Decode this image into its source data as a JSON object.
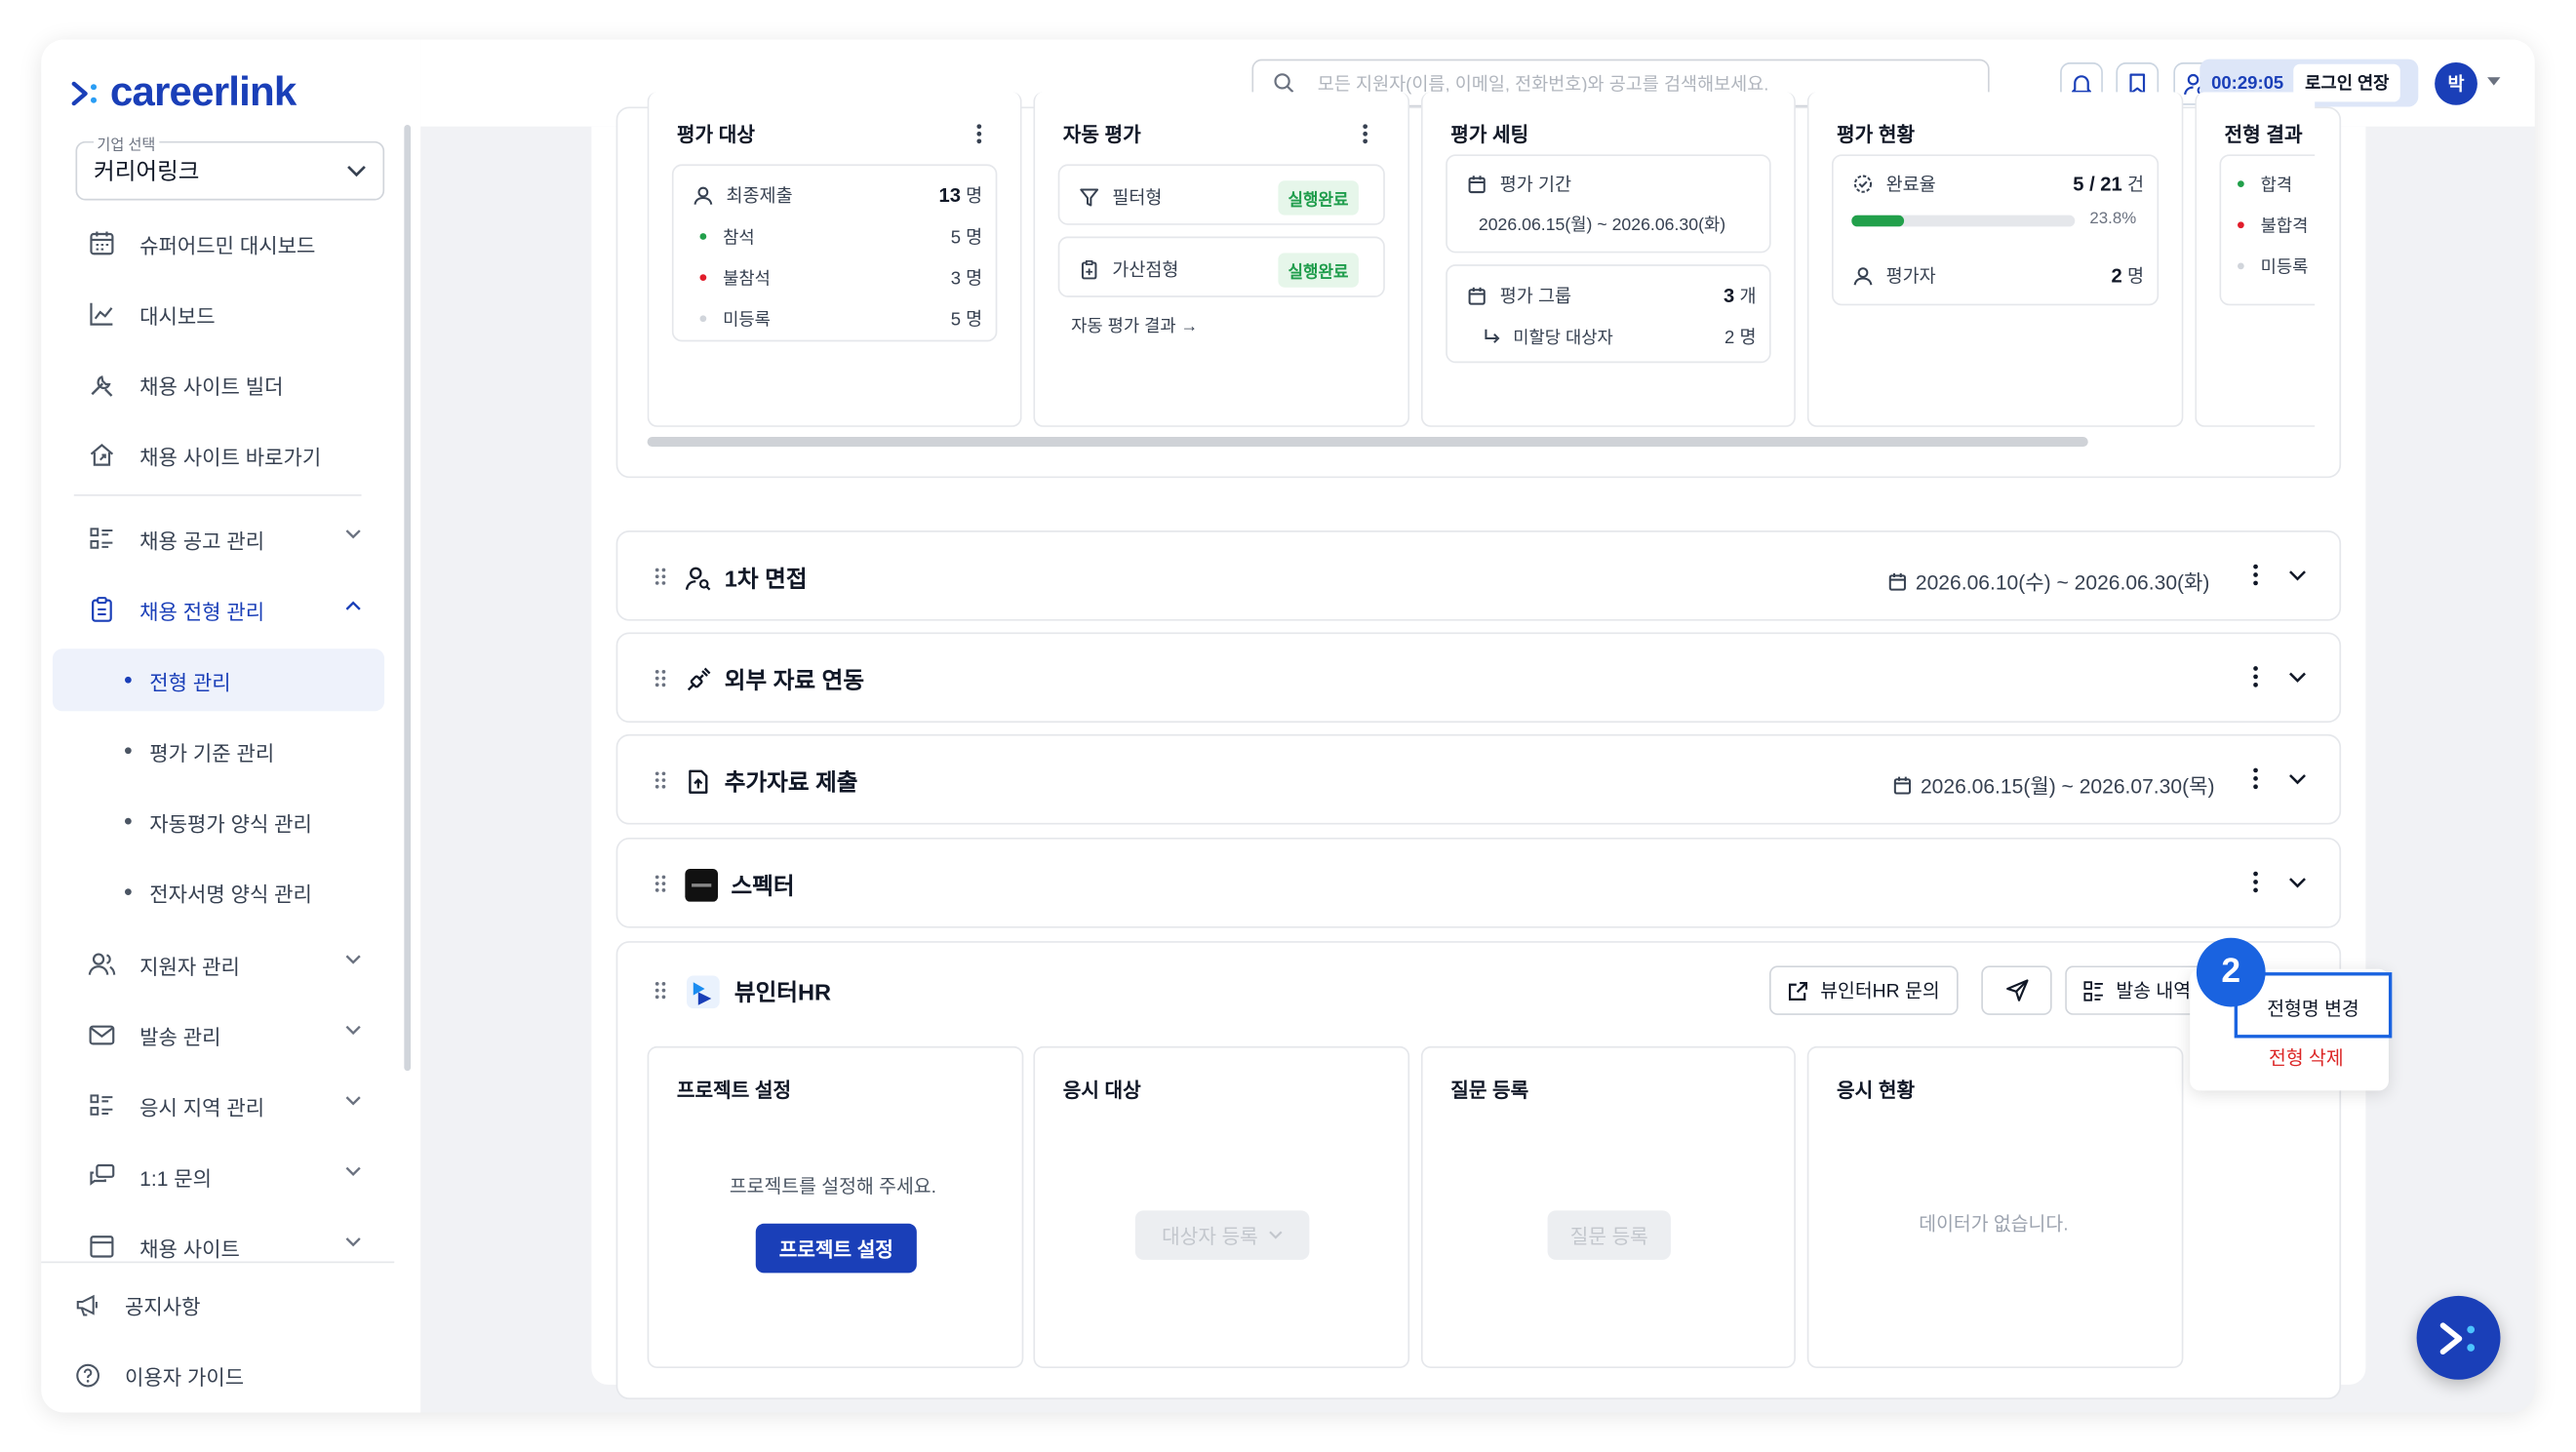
{
  "brand": {
    "name": "careerlink"
  },
  "company_select": {
    "label": "기업 선택",
    "value": "커리어링크"
  },
  "sidebar": {
    "items": [
      {
        "label": "슈퍼어드민 대시보드",
        "icon": "calendar-icon"
      },
      {
        "label": "대시보드",
        "icon": "chart-icon"
      },
      {
        "label": "채용 사이트 빌더",
        "icon": "tools-icon"
      },
      {
        "label": "채용 사이트 바로가기",
        "icon": "home-icon"
      },
      {
        "label": "채용 공고 관리",
        "icon": "list-icon"
      },
      {
        "label": "채용 전형 관리",
        "icon": "clipboard-icon"
      },
      {
        "label": "지원자 관리",
        "icon": "users-icon"
      },
      {
        "label": "발송 관리",
        "icon": "mail-icon"
      },
      {
        "label": "응시 지역 관리",
        "icon": "list-icon"
      },
      {
        "label": "1:1 문의",
        "icon": "chat-icon"
      },
      {
        "label": "채용 사이트",
        "icon": "window-icon"
      }
    ],
    "sub_items": [
      "전형 관리",
      "평가 기준 관리",
      "자동평가 양식 관리",
      "전자서명 양식 관리"
    ],
    "bottom": [
      {
        "label": "공지사항",
        "icon": "megaphone-icon"
      },
      {
        "label": "이용자 가이드",
        "icon": "help-icon"
      }
    ]
  },
  "header": {
    "search_placeholder": "모든 지원자(이름, 이메일, 전화번호)와 공고를 검색해보세요.",
    "timer": "00:29:05",
    "extend_label": "로그인 연장",
    "avatar": "박"
  },
  "eval": {
    "target": {
      "title": "평가 대상",
      "final": {
        "label": "최종제출",
        "count": "13",
        "unit": "명"
      },
      "rows": [
        {
          "label": "참석",
          "value": "5 명",
          "color": "#22a04b"
        },
        {
          "label": "불참석",
          "value": "3 명",
          "color": "#e11d2b"
        },
        {
          "label": "미등록",
          "value": "5 명",
          "color": "#d1d5db"
        }
      ]
    },
    "auto": {
      "title": "자동 평가",
      "filter": {
        "label": "필터형",
        "status": "실행완료"
      },
      "bonus": {
        "label": "가산점형",
        "status": "실행완료"
      },
      "result_link": "자동 평가 결과 →"
    },
    "setting": {
      "title": "평가 세팅",
      "period_label": "평가 기간",
      "period": "2026.06.15(월) ~ 2026.06.30(화)",
      "group_label": "평가 그룹",
      "group_count": "3",
      "group_unit": "개",
      "unassigned_label": "미할당 대상자",
      "unassigned_value": "2 명"
    },
    "status": {
      "title": "평가 현황",
      "completion_label": "완료율",
      "completion_value": "5 / 21",
      "completion_unit": "건",
      "completion_pct": "23.8%",
      "completion_fraction": 0.238,
      "evaluator_label": "평가자",
      "evaluator_count": "2",
      "evaluator_unit": "명"
    },
    "result": {
      "title": "전형 결과",
      "rows": [
        {
          "label": "합격",
          "color": "#22a04b"
        },
        {
          "label": "불합격",
          "color": "#e11d2b"
        },
        {
          "label": "미등록",
          "color": "#d1d5db"
        }
      ]
    }
  },
  "stages": [
    {
      "title": "1차 면접",
      "date": "2026.06.10(수) ~ 2026.06.30(화)",
      "icon": "interview-icon"
    },
    {
      "title": "외부 자료 연동",
      "date": "",
      "icon": "link-icon"
    },
    {
      "title": "추가자료 제출",
      "date": "2026.06.15(월) ~ 2026.07.30(목)",
      "icon": "upload-file-icon"
    },
    {
      "title": "스펙터",
      "date": "",
      "icon": "specter-logo"
    }
  ],
  "viewinter": {
    "title": "뷰인터HR",
    "inquiry_label": "뷰인터HR 문의",
    "history_label": "발송 내역",
    "columns": {
      "project": {
        "title": "프로젝트 설정",
        "message": "프로젝트를 설정해 주세요.",
        "button": "프로젝트 설정"
      },
      "target": {
        "title": "응시 대상",
        "button": "대상자 등록"
      },
      "question": {
        "title": "질문 등록",
        "button": "질문 등록"
      },
      "status": {
        "title": "응시 현황",
        "empty": "데이터가 없습니다."
      }
    }
  },
  "dropdown": {
    "rename": "전형명 변경",
    "delete": "전형 삭제"
  },
  "step_badge": "2",
  "colors": {
    "primary": "#1a3fb8",
    "highlight": "#1a63e0",
    "success": "#1f9d4c",
    "danger": "#dc2626"
  }
}
